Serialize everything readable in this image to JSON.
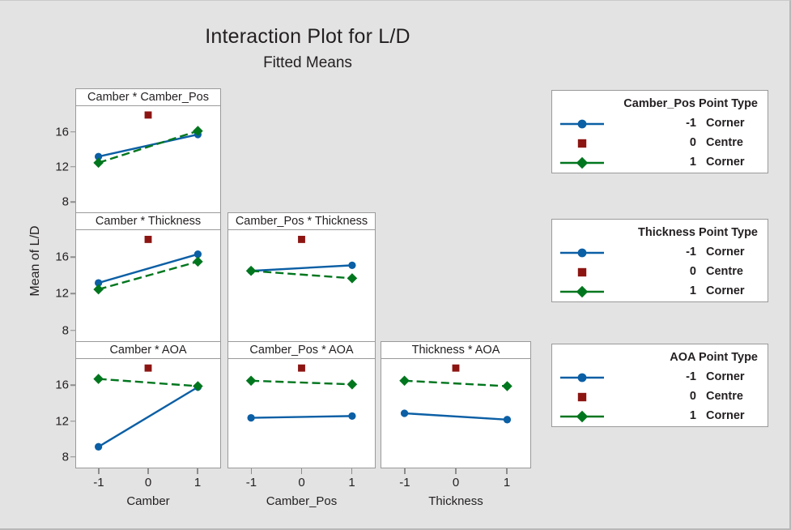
{
  "chart_data": {
    "type": "line",
    "title": "Interaction Plot for L/D",
    "subtitle": "Fitted Means",
    "ylabel": "Mean of L/D",
    "ylim": [
      7.0,
      19.0
    ],
    "yticks": [
      "8",
      "12",
      "16"
    ],
    "ytick_values": [
      8,
      12,
      16
    ],
    "xticks": [
      "-1",
      "0",
      "1"
    ],
    "xtick_values": [
      -1,
      0,
      1
    ],
    "xlim": [
      -1.45,
      1.45
    ],
    "grid": false,
    "colors": {
      "corner_low": "#0b5fa5",
      "centre": "#8c1512",
      "corner_high": "#00761e",
      "panel_border": "#9a9a9a",
      "background": "#e3e3e3",
      "panel_background": "#ffffff",
      "text": "#231f20"
    },
    "column_variables": [
      "Camber",
      "Camber_Pos",
      "Thickness"
    ],
    "row_variables": [
      "Camber_Pos",
      "Thickness",
      "AOA"
    ],
    "panels": [
      {
        "id": "camber-camber_pos",
        "title": "Camber * Camber_Pos",
        "row": 0,
        "col": 0,
        "xvar": "Camber",
        "trace_var": "Camber_Pos",
        "series": [
          {
            "name": "-1",
            "point_type": "Corner",
            "style": "solid",
            "marker": "circle",
            "color": "#0b5fa5",
            "x": [
              -1,
              1
            ],
            "values": [
              13.3,
              15.8
            ]
          },
          {
            "name": "0",
            "point_type": "Centre",
            "style": "none",
            "marker": "square",
            "color": "#8c1512",
            "x": [
              0
            ],
            "values": [
              18.0
            ]
          },
          {
            "name": "1",
            "point_type": "Corner",
            "style": "dashed",
            "marker": "diamond",
            "color": "#00761e",
            "x": [
              -1,
              1
            ],
            "values": [
              12.6,
              16.2
            ]
          }
        ]
      },
      {
        "id": "camber-thickness",
        "title": "Camber * Thickness",
        "row": 1,
        "col": 0,
        "xvar": "Camber",
        "trace_var": "Thickness",
        "series": [
          {
            "name": "-1",
            "point_type": "Corner",
            "style": "solid",
            "marker": "circle",
            "color": "#0b5fa5",
            "x": [
              -1,
              1
            ],
            "values": [
              13.3,
              16.4
            ]
          },
          {
            "name": "0",
            "point_type": "Centre",
            "style": "none",
            "marker": "square",
            "color": "#8c1512",
            "x": [
              0
            ],
            "values": [
              18.0
            ]
          },
          {
            "name": "1",
            "point_type": "Corner",
            "style": "dashed",
            "marker": "diamond",
            "color": "#00761e",
            "x": [
              -1,
              1
            ],
            "values": [
              12.6,
              15.6
            ]
          }
        ]
      },
      {
        "id": "camber_pos-thickness",
        "title": "Camber_Pos * Thickness",
        "row": 1,
        "col": 1,
        "xvar": "Camber_Pos",
        "trace_var": "Thickness",
        "series": [
          {
            "name": "-1",
            "point_type": "Corner",
            "style": "solid",
            "marker": "circle",
            "color": "#0b5fa5",
            "x": [
              -1,
              1
            ],
            "values": [
              14.6,
              15.2
            ]
          },
          {
            "name": "0",
            "point_type": "Centre",
            "style": "none",
            "marker": "square",
            "color": "#8c1512",
            "x": [
              0
            ],
            "values": [
              18.0
            ]
          },
          {
            "name": "1",
            "point_type": "Corner",
            "style": "dashed",
            "marker": "diamond",
            "color": "#00761e",
            "x": [
              -1,
              1
            ],
            "values": [
              14.6,
              13.8
            ]
          }
        ]
      },
      {
        "id": "camber-aoa",
        "title": "Camber * AOA",
        "row": 2,
        "col": 0,
        "xvar": "Camber",
        "trace_var": "AOA",
        "series": [
          {
            "name": "-1",
            "point_type": "Corner",
            "style": "solid",
            "marker": "circle",
            "color": "#0b5fa5",
            "x": [
              -1,
              1
            ],
            "values": [
              9.3,
              15.9
            ]
          },
          {
            "name": "0",
            "point_type": "Centre",
            "style": "none",
            "marker": "square",
            "color": "#8c1512",
            "x": [
              0
            ],
            "values": [
              18.0
            ]
          },
          {
            "name": "1",
            "point_type": "Corner",
            "style": "dashed",
            "marker": "diamond",
            "color": "#00761e",
            "x": [
              -1,
              1
            ],
            "values": [
              16.8,
              16.0
            ]
          }
        ]
      },
      {
        "id": "camber_pos-aoa",
        "title": "Camber_Pos * AOA",
        "row": 2,
        "col": 1,
        "xvar": "Camber_Pos",
        "trace_var": "AOA",
        "series": [
          {
            "name": "-1",
            "point_type": "Corner",
            "style": "solid",
            "marker": "circle",
            "color": "#0b5fa5",
            "x": [
              -1,
              1
            ],
            "values": [
              12.5,
              12.7
            ]
          },
          {
            "name": "0",
            "point_type": "Centre",
            "style": "none",
            "marker": "square",
            "color": "#8c1512",
            "x": [
              0
            ],
            "values": [
              18.0
            ]
          },
          {
            "name": "1",
            "point_type": "Corner",
            "style": "dashed",
            "marker": "diamond",
            "color": "#00761e",
            "x": [
              -1,
              1
            ],
            "values": [
              16.6,
              16.2
            ]
          }
        ]
      },
      {
        "id": "thickness-aoa",
        "title": "Thickness * AOA",
        "row": 2,
        "col": 2,
        "xvar": "Thickness",
        "trace_var": "AOA",
        "series": [
          {
            "name": "-1",
            "point_type": "Corner",
            "style": "solid",
            "marker": "circle",
            "color": "#0b5fa5",
            "x": [
              -1,
              1
            ],
            "values": [
              13.0,
              12.3
            ]
          },
          {
            "name": "0",
            "point_type": "Centre",
            "style": "none",
            "marker": "square",
            "color": "#8c1512",
            "x": [
              0
            ],
            "values": [
              18.0
            ]
          },
          {
            "name": "1",
            "point_type": "Corner",
            "style": "dashed",
            "marker": "diamond",
            "color": "#00761e",
            "x": [
              -1,
              1
            ],
            "values": [
              16.6,
              16.0
            ]
          }
        ]
      }
    ],
    "legends": [
      {
        "id": "camber_pos",
        "variable": "Camber_Pos",
        "header": "Point Type",
        "rows": [
          {
            "value": "-1",
            "type": "Corner",
            "marker": "circle",
            "style": "solid",
            "color": "#0b5fa5"
          },
          {
            "value": "0",
            "type": "Centre",
            "marker": "square",
            "style": "none",
            "color": "#8c1512"
          },
          {
            "value": "1",
            "type": "Corner",
            "marker": "diamond",
            "style": "solid",
            "color": "#00761e"
          }
        ]
      },
      {
        "id": "thickness",
        "variable": "Thickness",
        "header": "Point Type",
        "rows": [
          {
            "value": "-1",
            "type": "Corner",
            "marker": "circle",
            "style": "solid",
            "color": "#0b5fa5"
          },
          {
            "value": "0",
            "type": "Centre",
            "marker": "square",
            "style": "none",
            "color": "#8c1512"
          },
          {
            "value": "1",
            "type": "Corner",
            "marker": "diamond",
            "style": "solid",
            "color": "#00761e"
          }
        ]
      },
      {
        "id": "aoa",
        "variable": "AOA",
        "header": "Point Type",
        "rows": [
          {
            "value": "-1",
            "type": "Corner",
            "marker": "circle",
            "style": "solid",
            "color": "#0b5fa5"
          },
          {
            "value": "0",
            "type": "Centre",
            "marker": "square",
            "style": "none",
            "color": "#8c1512"
          },
          {
            "value": "1",
            "type": "Corner",
            "marker": "diamond",
            "style": "solid",
            "color": "#00761e"
          }
        ]
      }
    ]
  }
}
